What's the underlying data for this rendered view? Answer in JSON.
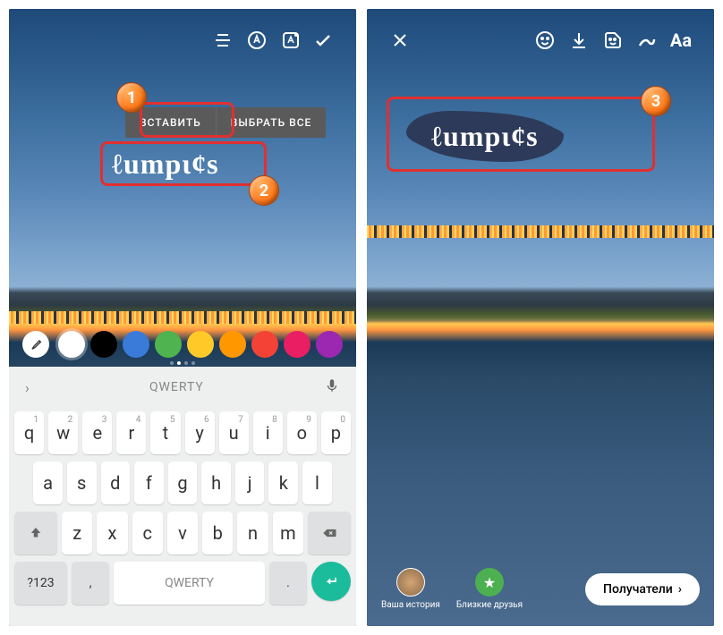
{
  "left": {
    "contextMenu": {
      "paste": "ВСТАВИТЬ",
      "selectAll": "ВЫБРАТЬ ВСЕ"
    },
    "overlayText": "ℓumpɩ¢s",
    "suggestion": "QWERTY",
    "row1": [
      "q",
      "w",
      "e",
      "r",
      "t",
      "y",
      "u",
      "i",
      "o",
      "p"
    ],
    "nums": [
      "1",
      "2",
      "3",
      "4",
      "5",
      "6",
      "7",
      "8",
      "9",
      "0"
    ],
    "row2": [
      "a",
      "s",
      "d",
      "f",
      "g",
      "h",
      "j",
      "k",
      "l"
    ],
    "row3": [
      "z",
      "x",
      "c",
      "v",
      "b",
      "n",
      "m"
    ],
    "symKey": "?123",
    "emojiKey": ",",
    "spaceKey": "QWERTY",
    "periodKey": ".",
    "palette": [
      "#ffffff",
      "#000000",
      "#3a7ad9",
      "#4fb34f",
      "#ffca28",
      "#ff9800",
      "#f44336",
      "#e91e63",
      "#9c27b0"
    ]
  },
  "right": {
    "aaLabel": "Aa",
    "overlayText": "ℓumpɩ¢s",
    "story": "Ваша история",
    "friends": "Близкие друзья",
    "recipients": "Получатели"
  },
  "badges": {
    "b1": "1",
    "b2": "2",
    "b3": "3"
  }
}
